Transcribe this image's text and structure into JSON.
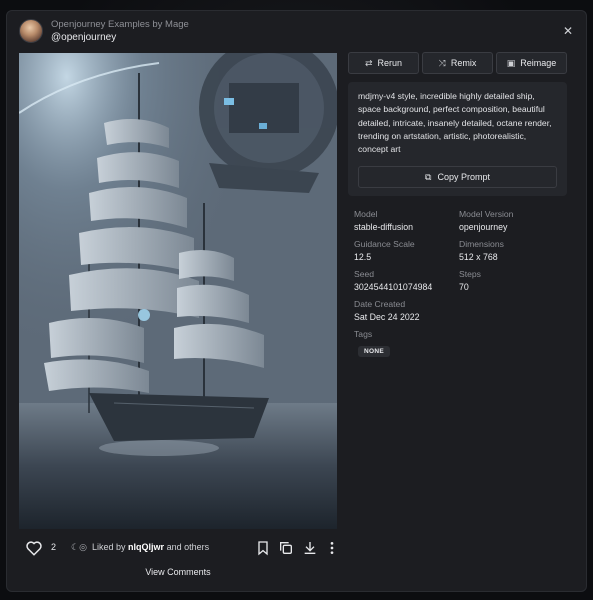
{
  "header": {
    "gallery_title": "Openjourney Examples by Mage",
    "username": "@openjourney",
    "close_icon": "close-icon"
  },
  "actions": {
    "rerun": "Rerun",
    "remix": "Remix",
    "reimage": "Reimage"
  },
  "prompt": {
    "text": "mdjmy-v4 style, incredible highly detailed ship, space background, perfect composition, beautiful detailed, intricate, insanely detailed, octane render, trending on artstation, artistic, photorealistic, concept art",
    "copy_label": "Copy Prompt"
  },
  "meta": {
    "model_label": "Model",
    "model_value": "stable-diffusion",
    "model_version_label": "Model Version",
    "model_version_value": "openjourney",
    "guidance_label": "Guidance Scale",
    "guidance_value": "12.5",
    "dimensions_label": "Dimensions",
    "dimensions_value": "512 x 768",
    "seed_label": "Seed",
    "seed_value": "3024544101074984",
    "steps_label": "Steps",
    "steps_value": "70",
    "date_label": "Date Created",
    "date_value": "Sat Dec 24 2022",
    "tags_label": "Tags",
    "tag_none": "NONE"
  },
  "footer": {
    "like_count": "2",
    "liked_by_prefix": "Liked by",
    "liked_by_user": "nlqQljwr",
    "liked_by_suffix": "and others",
    "view_comments": "View Comments"
  }
}
